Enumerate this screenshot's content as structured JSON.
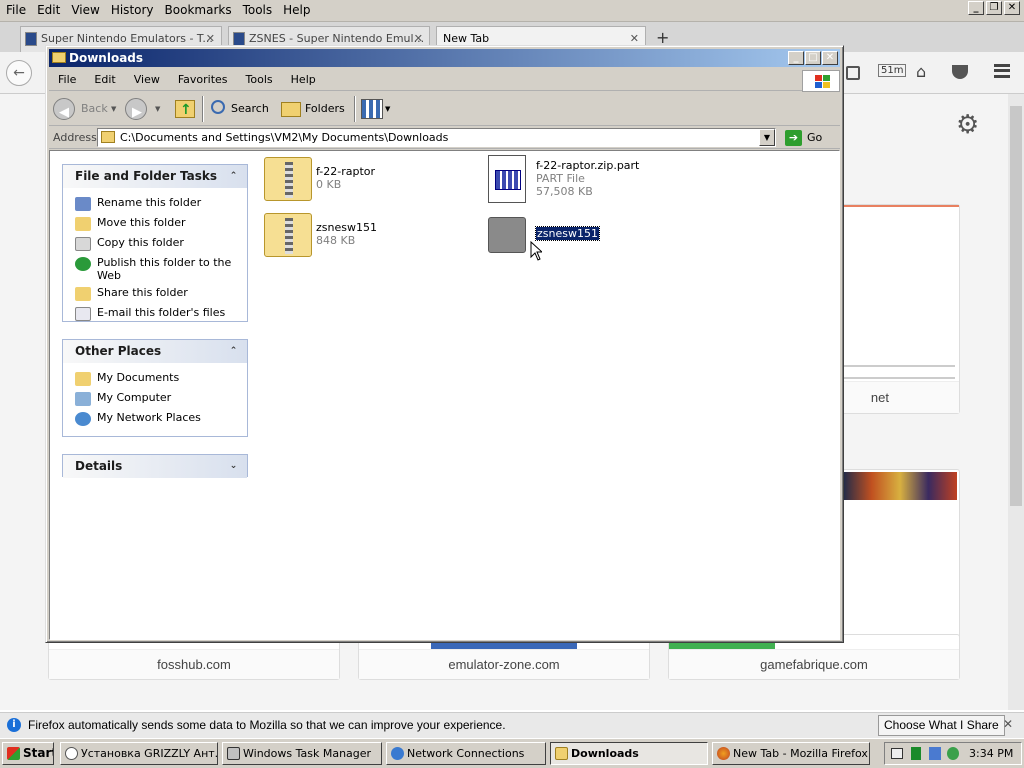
{
  "firefox": {
    "menu": [
      "File",
      "Edit",
      "View",
      "History",
      "Bookmarks",
      "Tools",
      "Help"
    ],
    "tabs": [
      {
        "title": "Super Nintendo Emulators - T..."
      },
      {
        "title": "ZSNES - Super Nintendo Emul..."
      },
      {
        "title": "New Tab"
      }
    ],
    "new_tab_symbol": "+",
    "toolbar": {
      "timer": "51m"
    },
    "tiles": [
      {
        "label": "fosshub.com"
      },
      {
        "label": "emulator-zone.com"
      },
      {
        "label": "gamefabrique.com"
      },
      {
        "label": "net"
      }
    ],
    "notification": {
      "text": "Firefox automatically sends some data to Mozilla so that we can improve your experience.",
      "button": "Choose What I Share"
    }
  },
  "explorer": {
    "title": "Downloads",
    "menu": [
      "File",
      "Edit",
      "View",
      "Favorites",
      "Tools",
      "Help"
    ],
    "toolbar": {
      "back": "Back",
      "search": "Search",
      "folders": "Folders"
    },
    "address": {
      "label": "Address",
      "value": "C:\\Documents and Settings\\VM2\\My Documents\\Downloads",
      "go": "Go"
    },
    "tasks_panel": {
      "title": "File and Folder Tasks",
      "items": [
        "Rename this folder",
        "Move this folder",
        "Copy this folder",
        "Publish this folder to the Web",
        "Share this folder",
        "E-mail this folder's files"
      ]
    },
    "places_panel": {
      "title": "Other Places",
      "items": [
        "My Documents",
        "My Computer",
        "My Network Places"
      ]
    },
    "details_panel": {
      "title": "Details"
    },
    "files": [
      {
        "name": "f-22-raptor",
        "sub": "0 KB"
      },
      {
        "name": "f-22-raptor.zip.part",
        "sub": "PART File",
        "size": "57,508 KB"
      },
      {
        "name": "zsnesw151",
        "sub": "848 KB"
      },
      {
        "name": "zsnesw151"
      }
    ]
  },
  "taskbar": {
    "start": "Start",
    "buttons": [
      {
        "label": "Установка GRIZZLY Ант..."
      },
      {
        "label": "Windows Task Manager"
      },
      {
        "label": "Network Connections"
      },
      {
        "label": "Downloads"
      },
      {
        "label": "New Tab - Mozilla Firefox"
      }
    ],
    "clock": "3:34 PM"
  }
}
